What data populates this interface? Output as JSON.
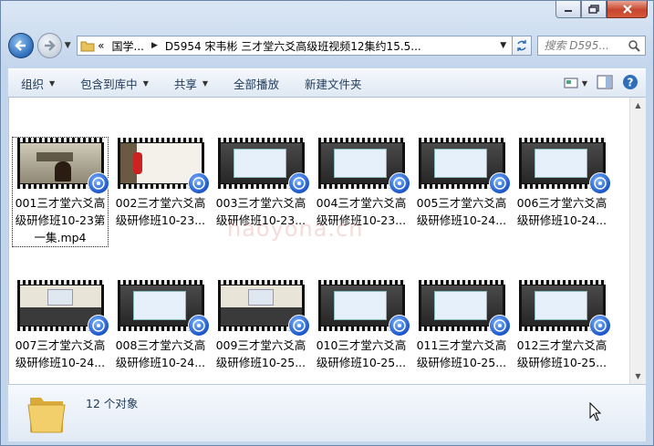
{
  "window": {
    "caption": {
      "minimize": "minimize",
      "maximize": "maximize",
      "close": "close"
    }
  },
  "address": {
    "overflow": "«",
    "crumbs": [
      "国学...",
      "D5954 宋韦彬 三才堂六爻高级班视频12集约15.5..."
    ]
  },
  "search": {
    "placeholder": "搜索 D595..."
  },
  "toolbar": {
    "organize": "组织",
    "include_library": "包含到库中",
    "share": "共享",
    "play_all": "全部播放",
    "new_folder": "新建文件夹"
  },
  "files": [
    {
      "name": "001三才堂六爻高级研修班10-23第一集.mp4",
      "scene": "teacher"
    },
    {
      "name": "002三才堂六爻高级研修班10-23...",
      "scene": "board"
    },
    {
      "name": "003三才堂六爻高级研修班10-23...",
      "scene": "slide"
    },
    {
      "name": "004三才堂六爻高级研修班10-23...",
      "scene": "slide"
    },
    {
      "name": "005三才堂六爻高级研修班10-24...",
      "scene": "slide"
    },
    {
      "name": "006三才堂六爻高级研修班10-24...",
      "scene": "slide"
    },
    {
      "name": "007三才堂六爻高级研修班10-24...",
      "scene": "room"
    },
    {
      "name": "008三才堂六爻高级研修班10-24...",
      "scene": "slide"
    },
    {
      "name": "009三才堂六爻高级研修班10-25...",
      "scene": "room"
    },
    {
      "name": "010三才堂六爻高级研修班10-25...",
      "scene": "slide"
    },
    {
      "name": "011三才堂六爻高级研修班10-25...",
      "scene": "slide"
    },
    {
      "name": "012三才堂六爻高级研修班10-25...",
      "scene": "slide"
    }
  ],
  "details": {
    "count": "12 个对象"
  },
  "watermark": "haoyona.cn",
  "colors": {
    "accent": "#1e395b",
    "badge": "#1b56c8",
    "close": "#c7452d"
  }
}
